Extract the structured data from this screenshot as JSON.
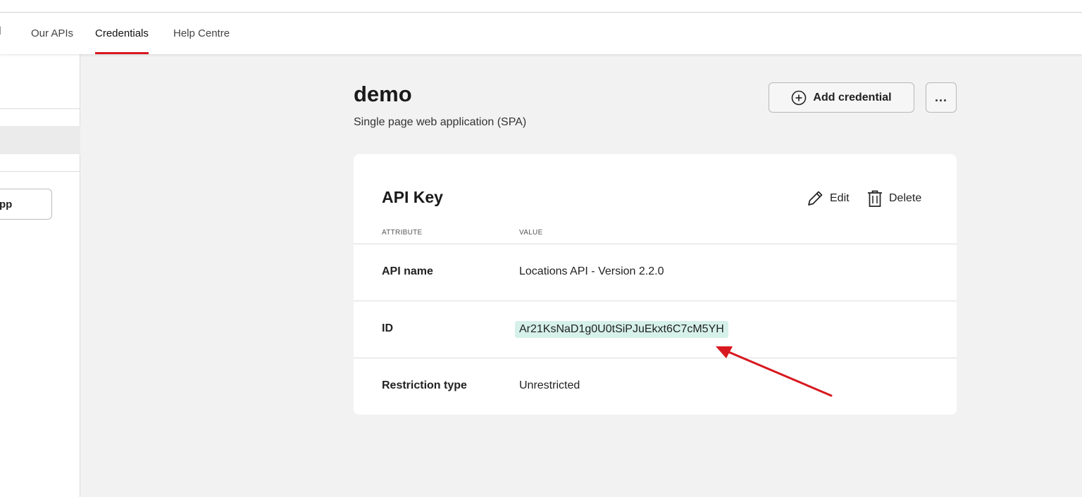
{
  "nav": {
    "brand_fragment": "l",
    "items": [
      {
        "label": "Our APIs"
      },
      {
        "label": "Credentials"
      },
      {
        "label": "Help Centre"
      }
    ]
  },
  "sidebar": {
    "button_fragment": "pp"
  },
  "page": {
    "title": "demo",
    "subtitle": "Single page web application (SPA)",
    "add_credential_label": "Add credential",
    "more_label": "..."
  },
  "card": {
    "title": "API Key",
    "edit_label": "Edit",
    "delete_label": "Delete",
    "columns": [
      "ATTRIBUTE",
      "VALUE"
    ],
    "rows": [
      {
        "attribute": "API name",
        "value": "Locations API - Version 2.2.0"
      },
      {
        "attribute": "ID",
        "value": "Ar21KsNaD1g0U0tSiPJuEkxt6C7cM5YH"
      },
      {
        "attribute": "Restriction type",
        "value": "Unrestricted"
      }
    ]
  },
  "colors": {
    "accent": "#d7191f",
    "id_highlight": "#d6f1ea",
    "arrow": "#d7191f"
  }
}
